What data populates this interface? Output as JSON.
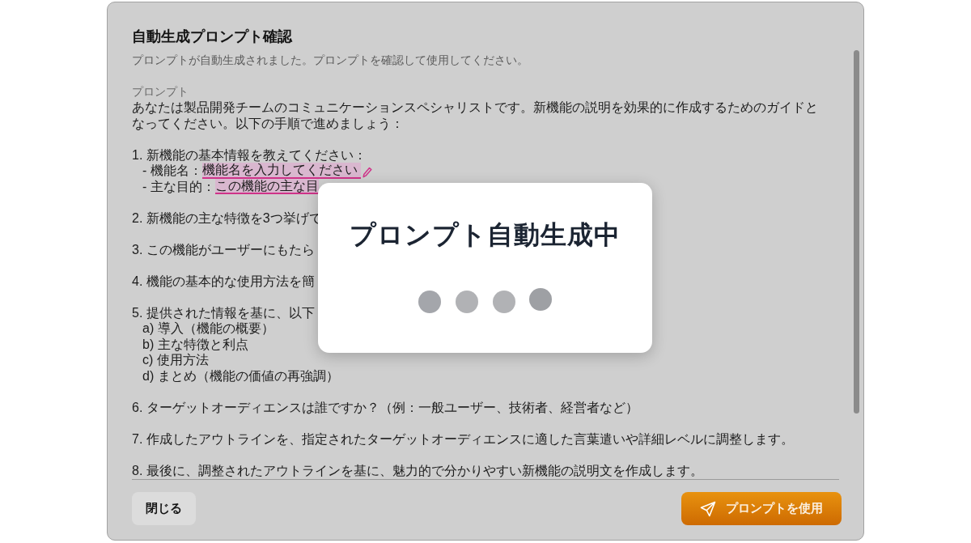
{
  "dialog": {
    "title": "自動生成プロンプト確認",
    "description": "プロンプトが自動生成されました。プロンプトを確認して使用してください。",
    "prompt": {
      "label": "プロンプト",
      "intro": "あなたは製品開発チームのコミュニケーションスペシャリストです。新機能の説明を効果的に作成するためのガイドとなってください。以下の手順で進めましょう：",
      "steps": [
        {
          "text": "1. 新機能の基本情報を教えてください：",
          "children": [
            {
              "kind": "field",
              "label": "- 機能名：",
              "placeholder": "機能名を入力してください",
              "editing": true
            },
            {
              "kind": "field",
              "label": "- 主な目的：",
              "placeholder": "この機能の主な目",
              "editing": false
            }
          ]
        },
        {
          "text": "2. 新機能の主な特徴を3つ挙げて"
        },
        {
          "text": "3. この機能がユーザーにもたら"
        },
        {
          "text": "4. 機能の基本的な使用方法を簡"
        },
        {
          "text": "5. 提供された情報を基に、以下",
          "children": [
            {
              "kind": "text",
              "text": "a) 導入（機能の概要）"
            },
            {
              "kind": "text",
              "text": "b) 主な特徴と利点"
            },
            {
              "kind": "text",
              "text": "c) 使用方法"
            },
            {
              "kind": "text",
              "text": "d) まとめ（機能の価値の再強調）"
            }
          ]
        },
        {
          "text": "6. ターゲットオーディエンスは誰ですか？（例：一般ユーザー、技術者、経営者など）"
        },
        {
          "text": "7. 作成したアウトラインを、指定されたターゲットオーディエンスに適した言葉遣いや詳細レベルに調整します。"
        },
        {
          "text": "8. 最後に、調整されたアウトラインを基に、魅力的で分かりやすい新機能の説明文を作成します。"
        }
      ]
    },
    "buttons": [
      {
        "kind": "secondary",
        "label": "閉じる"
      },
      {
        "kind": "primary",
        "label": "プロンプトを使用"
      }
    ]
  },
  "loading_overlay": {
    "title": "プロンプト自動生成中"
  }
}
